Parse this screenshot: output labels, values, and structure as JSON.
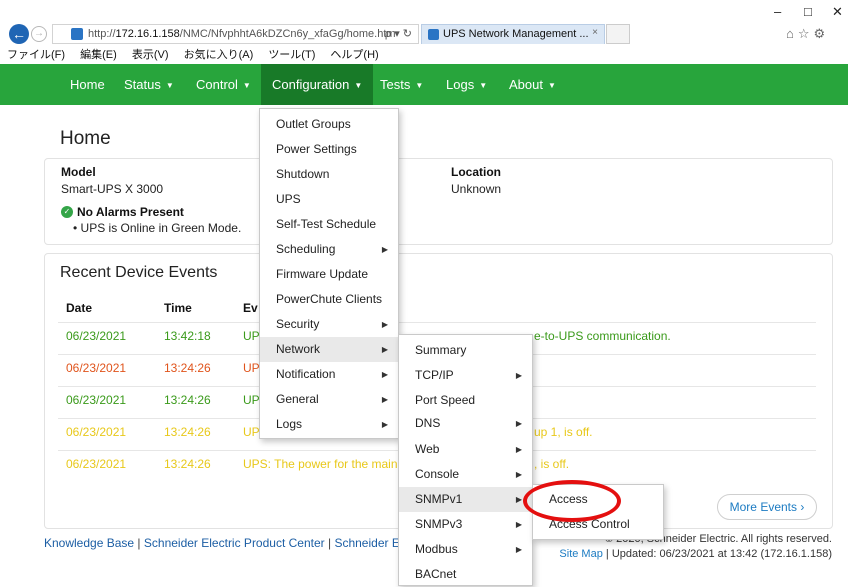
{
  "browser": {
    "url_prefix": "http://",
    "url_host": "172.16.1.158",
    "url_path": "/NMC/NfvphhtA6kDZCn6y_xfaGg/home.htm",
    "addr_tools": "ρ ▾ ↻",
    "tab_title": "UPS Network Management ...",
    "tab_close": "×",
    "window_controls": [
      "–",
      "□",
      "✕"
    ],
    "toolbar_icons": "⌂☆⚙",
    "menubar": [
      "ファイル(F)",
      "編集(E)",
      "表示(V)",
      "お気に入り(A)",
      "ツール(T)",
      "ヘルプ(H)"
    ]
  },
  "nav": {
    "items": [
      {
        "label": "Home",
        "caret": ""
      },
      {
        "label": "Status",
        "caret": "▼"
      },
      {
        "label": "Control",
        "caret": "▼"
      },
      {
        "label": "Configuration",
        "caret": "▼"
      },
      {
        "label": "Tests",
        "caret": "▼"
      },
      {
        "label": "Logs",
        "caret": "▼"
      },
      {
        "label": "About",
        "caret": "▼"
      }
    ]
  },
  "page": {
    "title": "Home",
    "model_label": "Model",
    "model_value": "Smart-UPS X 3000",
    "location_label": "Location",
    "location_value": "Unknown",
    "alarm_status": "No Alarms Present",
    "status_bullet": "• UPS is Online in Green Mode."
  },
  "events": {
    "title": "Recent Device Events",
    "headers": [
      "Date",
      "Time",
      "Ev"
    ],
    "rows": [
      {
        "date": "06/23/2021",
        "time": "13:42:18",
        "ev": "UP",
        "tail": "e-to-UPS communication.",
        "color": "#3a9a1a"
      },
      {
        "date": "06/23/2021",
        "time": "13:24:26",
        "ev": "UP",
        "tail": "",
        "color": "#e0541c"
      },
      {
        "date": "06/23/2021",
        "time": "13:24:26",
        "ev": "UP",
        "tail": "",
        "color": "#3a9a1a"
      },
      {
        "date": "06/23/2021",
        "time": "13:24:26",
        "ev": "UP",
        "tail": "up 1, is off.",
        "color": "#e8c81a"
      },
      {
        "date": "06/23/2021",
        "time": "13:24:26",
        "ev": "UPS: The power for the main",
        "tail": ", is off.",
        "color": "#e8c81a"
      }
    ],
    "more_label": "More Events ›"
  },
  "footer": {
    "links": [
      "Knowledge Base",
      "Schneider Electric Product Center",
      "Schneider Ele"
    ],
    "sep": "|",
    "copyright": "© 2020, Schneider Electric. All rights reserved.",
    "site_map": "Site Map",
    "updated": "| Updated: 06/23/2021 at 13:42 (172.16.1.158)"
  },
  "config_menu": {
    "items": [
      {
        "label": "Outlet Groups",
        "arrow": ""
      },
      {
        "label": "Power Settings",
        "arrow": ""
      },
      {
        "label": "Shutdown",
        "arrow": ""
      },
      {
        "label": "UPS",
        "arrow": ""
      },
      {
        "label": "Self-Test Schedule",
        "arrow": ""
      },
      {
        "label": "Scheduling",
        "arrow": "▶"
      },
      {
        "label": "Firmware Update",
        "arrow": ""
      },
      {
        "label": "PowerChute Clients",
        "arrow": ""
      },
      {
        "label": "Security",
        "arrow": "▶"
      },
      {
        "label": "Network",
        "arrow": "▶"
      },
      {
        "label": "Notification",
        "arrow": "▶"
      },
      {
        "label": "General",
        "arrow": "▶"
      },
      {
        "label": "Logs",
        "arrow": "▶"
      }
    ]
  },
  "network_menu": {
    "items": [
      {
        "label": "Summary",
        "arrow": ""
      },
      {
        "label": "TCP/IP",
        "arrow": "▶"
      },
      {
        "label": "Port Speed",
        "arrow": ""
      },
      {
        "label": "DNS",
        "arrow": "▶"
      },
      {
        "label": "Web",
        "arrow": "▶"
      },
      {
        "label": "Console",
        "arrow": "▶"
      },
      {
        "label": "SNMPv1",
        "arrow": "▶"
      },
      {
        "label": "SNMPv3",
        "arrow": "▶"
      },
      {
        "label": "Modbus",
        "arrow": "▶"
      },
      {
        "label": "BACnet",
        "arrow": ""
      }
    ]
  },
  "snmp_menu": {
    "items": [
      {
        "label": "Access"
      },
      {
        "label": "Access Control"
      }
    ]
  }
}
